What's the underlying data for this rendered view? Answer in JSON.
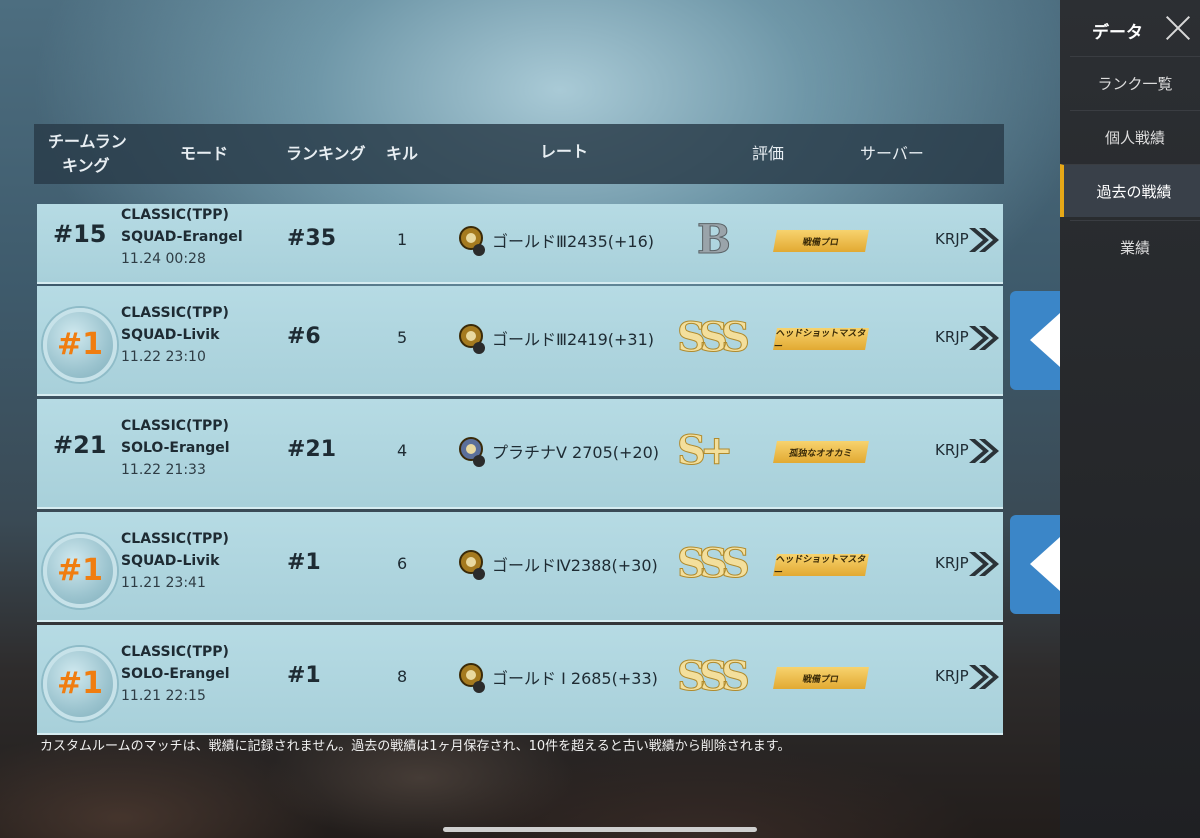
{
  "side": {
    "title": "データ",
    "items": [
      "ランク一覧",
      "個人戦績",
      "過去の戦績",
      "業績"
    ],
    "active_index": 2
  },
  "header": {
    "team_rank": "チームランキング",
    "team_rank_l1": "チームラン",
    "team_rank_l2": "キング",
    "mode": "モード",
    "ranking": "ランキング",
    "kill": "キル",
    "rate": "レート",
    "eval": "評価",
    "server": "サーバー"
  },
  "rows": [
    {
      "team_rank": "#15",
      "medal": false,
      "mode_l1": "CLASSIC(TPP)",
      "mode_l2": "SQUAD-Erangel",
      "time": "11.24 00:28",
      "ranking": "#35",
      "kill": "1",
      "rate": "ゴールドⅢ2435(+16)",
      "tier": "gold",
      "grade": "B",
      "badge": "戦備プロ",
      "server": "KRJP"
    },
    {
      "team_rank": "#1",
      "medal": true,
      "mode_l1": "CLASSIC(TPP)",
      "mode_l2": "SQUAD-Livik",
      "time": "11.22 23:10",
      "ranking": "#6",
      "kill": "5",
      "rate": "ゴールドⅢ2419(+31)",
      "tier": "gold",
      "grade": "SSS",
      "badge": "ヘッドショットマスター",
      "server": "KRJP"
    },
    {
      "team_rank": "#21",
      "medal": false,
      "mode_l1": "CLASSIC(TPP)",
      "mode_l2": "SOLO-Erangel",
      "time": "11.22 21:33",
      "ranking": "#21",
      "kill": "4",
      "rate": "プラチナⅤ 2705(+20)",
      "tier": "platinum",
      "grade": "S+",
      "badge": "孤独なオオカミ",
      "server": "KRJP"
    },
    {
      "team_rank": "#1",
      "medal": true,
      "mode_l1": "CLASSIC(TPP)",
      "mode_l2": "SQUAD-Livik",
      "time": "11.21 23:41",
      "ranking": "#1",
      "kill": "6",
      "rate": "ゴールドⅣ2388(+30)",
      "tier": "gold",
      "grade": "SSS",
      "badge": "ヘッドショットマスター",
      "server": "KRJP"
    },
    {
      "team_rank": "#1",
      "medal": true,
      "mode_l1": "CLASSIC(TPP)",
      "mode_l2": "SOLO-Erangel",
      "time": "11.21 22:15",
      "ranking": "#1",
      "kill": "8",
      "rate": "ゴールド Ⅰ 2685(+33)",
      "tier": "gold",
      "grade": "SSS",
      "badge": "戦備プロ",
      "server": "KRJP"
    }
  ],
  "note": "カスタムルームのマッチは、戦績に記録されません。過去の戦績は1ヶ月保存され、10件を超えると古い戦績から削除されます。",
  "colors": {
    "accent": "#e6a817",
    "arrow_button": "#3b86c8",
    "medal_text": "#f07d10"
  }
}
